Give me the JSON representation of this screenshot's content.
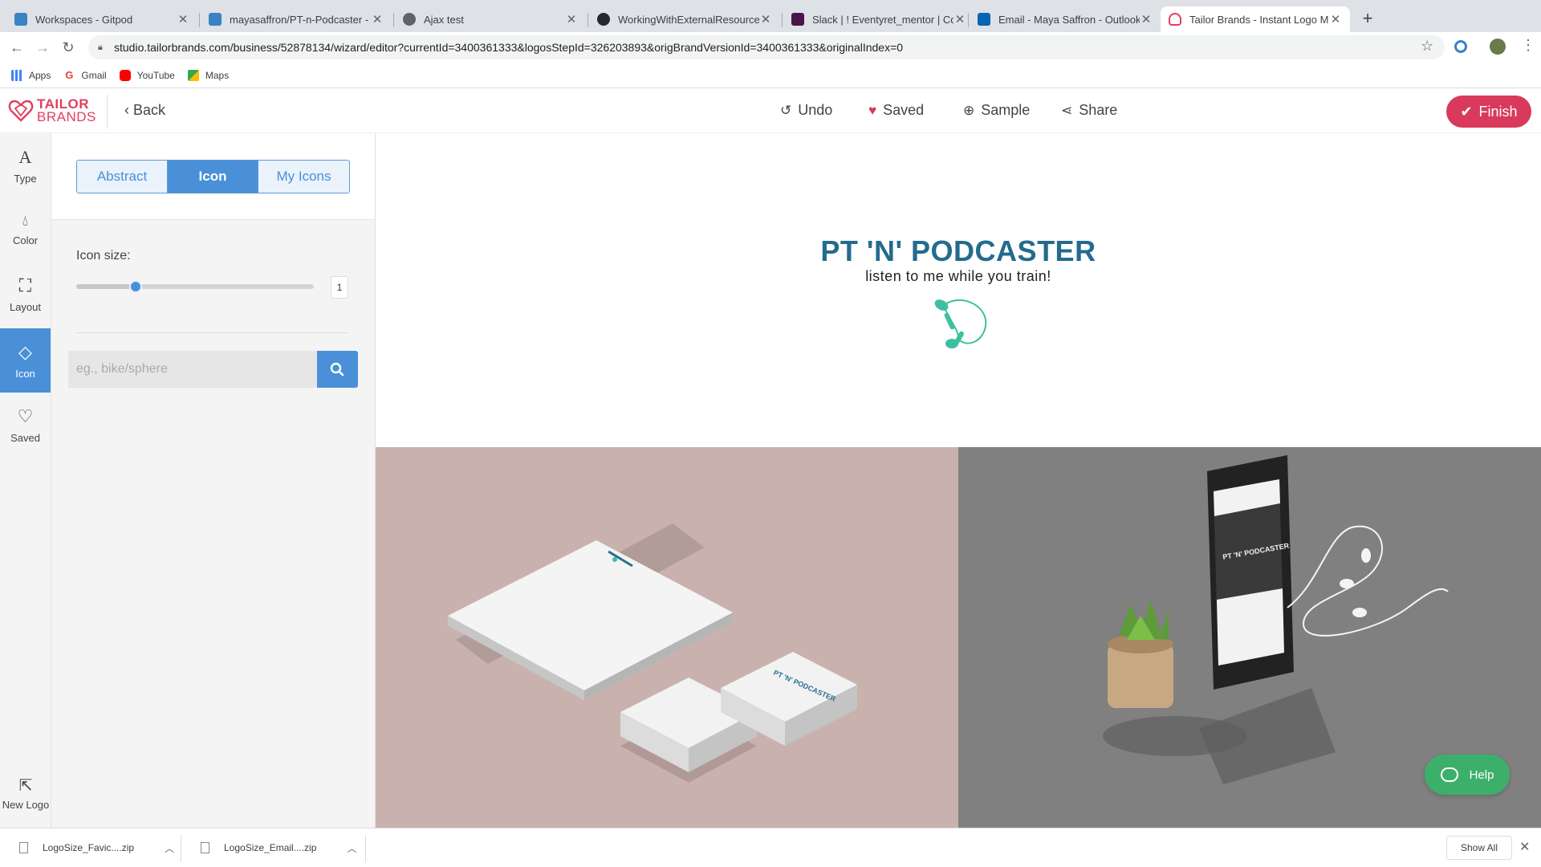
{
  "browser": {
    "tabs": [
      {
        "label": "Workspaces - Gitpod",
        "favicon_color": "#3b82c4"
      },
      {
        "label": "mayasaffron/PT-n-Podcaster -",
        "favicon_color": "#3b82c4"
      },
      {
        "label": "Ajax test",
        "favicon_color": "#5f6368"
      },
      {
        "label": "WorkingWithExternalResource",
        "favicon_color": "#24292e"
      },
      {
        "label": "Slack | ! Eventyret_mentor | Co",
        "favicon_color": "#4a154b"
      },
      {
        "label": "Email - Maya Saffron - Outlook",
        "favicon_color": "#0a64b4"
      },
      {
        "label": "Tailor Brands - Instant Logo M",
        "favicon_color": "#e0405e"
      }
    ],
    "new_tab": "+",
    "url": "studio.tailorbrands.com/business/52878134/wizard/editor?currentId=3400361333&logosStepId=326203893&origBrandVersionId=3400361333&originalIndex=0",
    "bookmarks": [
      {
        "label": "Apps",
        "color": "#4285f4"
      },
      {
        "label": "Gmail",
        "color": "#ea4335"
      },
      {
        "label": "YouTube",
        "color": "#ff0000"
      },
      {
        "label": "Maps",
        "color": "#34a853"
      }
    ]
  },
  "header": {
    "logo_line1": "TAILOR",
    "logo_line2": "BRANDS",
    "back": "Back",
    "undo": "Undo",
    "saved": "Saved",
    "sample": "Sample",
    "share": "Share",
    "finish": "Finish",
    "accent": "#d93a5c"
  },
  "rail": {
    "items": [
      {
        "label": "Type",
        "icon": "type-icon"
      },
      {
        "label": "Color",
        "icon": "drop-icon"
      },
      {
        "label": "Layout",
        "icon": "layout-icon"
      },
      {
        "label": "Icon",
        "icon": "diamond-icon"
      },
      {
        "label": "Saved",
        "icon": "heart-icon"
      }
    ],
    "active": "Icon",
    "new_logo": "New Logo"
  },
  "panel": {
    "tabs": [
      "Abstract",
      "Icon",
      "My Icons"
    ],
    "active_tab": "Icon",
    "icon_size_label": "Icon size:",
    "icon_size_value": "1",
    "icon_size_fraction": 0.25,
    "search_placeholder": "eg., bike/sphere"
  },
  "preview": {
    "brand_name": "PT 'N' PODCASTER",
    "slogan": "listen to me while you train!",
    "brand_color": "#236b8e",
    "icon_color": "#3dbfa0"
  },
  "mockups": {
    "mini_brand": "PT 'N' PODCASTER"
  },
  "help": "Help",
  "downloads": {
    "items": [
      "LogoSize_Favic....zip",
      "LogoSize_Email....zip"
    ],
    "show_all": "Show All"
  }
}
